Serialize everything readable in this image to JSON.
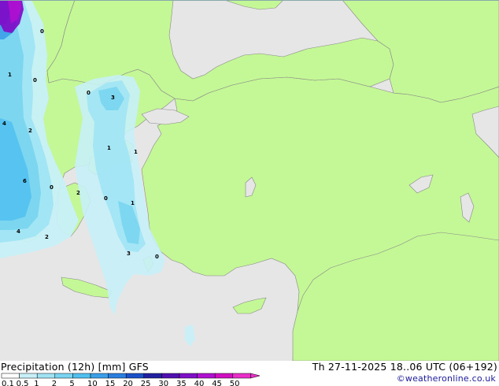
{
  "title": "Precipitation (12h) [mm] GFS",
  "valid_time": "Th 27-11-2025 18..06 UTC (06+192)",
  "credit": "©weatheronline.co.uk",
  "legend": {
    "ticks": [
      "0.1",
      "0.5",
      "1",
      "2",
      "5",
      "10",
      "15",
      "20",
      "25",
      "30",
      "35",
      "40",
      "45",
      "50"
    ],
    "colors": [
      "#ffffff",
      "#c8f0f8",
      "#a0e4f4",
      "#78d4f0",
      "#50c0f0",
      "#3ca0e8",
      "#2a7ee0",
      "#1a50c8",
      "#2020a0",
      "#5010b0",
      "#8010c8",
      "#b010d0",
      "#d010c0",
      "#e830c8"
    ]
  },
  "colors": {
    "land": "#c4f796",
    "sea": "#e6e6e6",
    "border": "#888888"
  },
  "map_values": [
    {
      "text": "0"
    },
    {
      "text": "1"
    },
    {
      "text": "0"
    },
    {
      "text": "0"
    },
    {
      "text": "3"
    },
    {
      "text": "4"
    },
    {
      "text": "2"
    },
    {
      "text": "1"
    },
    {
      "text": "1"
    },
    {
      "text": "6"
    },
    {
      "text": "0"
    },
    {
      "text": "2"
    },
    {
      "text": "0"
    },
    {
      "text": "1"
    },
    {
      "text": "4"
    },
    {
      "text": "2"
    },
    {
      "text": "3"
    },
    {
      "text": "0"
    }
  ]
}
